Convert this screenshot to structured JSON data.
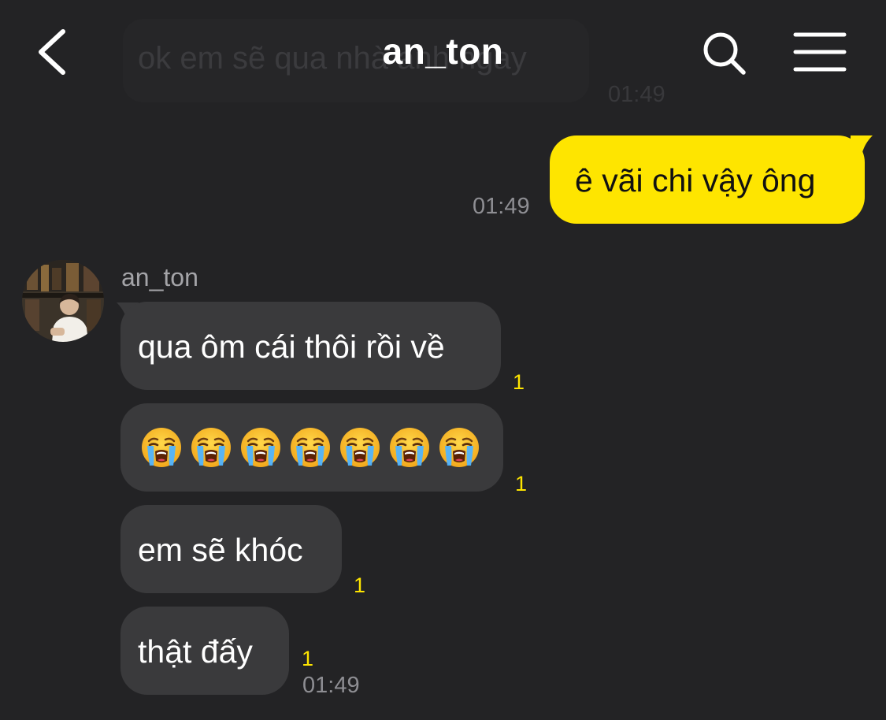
{
  "header": {
    "title": "an_ton",
    "back_icon": "chevron-left-icon",
    "search_icon": "search-icon",
    "menu_icon": "hamburger-menu-icon"
  },
  "ghost_message": {
    "text": "ok em sẽ qua nhà anh ngay",
    "time": "01:49"
  },
  "sent_message": {
    "text": "ê vãi chi vậy ông",
    "time": "01:49"
  },
  "received": {
    "sender_name": "an_ton",
    "avatar_icon": "avatar-photo",
    "messages": [
      {
        "text": "qua ôm cái thôi rồi về",
        "unread": "1"
      },
      {
        "text": "😭😭😭😭😭😭😭",
        "unread": "1",
        "emoji_icon": "loudly-crying-face-icon"
      },
      {
        "text": "em sẽ khóc",
        "unread": "1"
      },
      {
        "text": "thật đấy",
        "unread": "1"
      }
    ],
    "time": "01:49"
  },
  "colors": {
    "background": "#232325",
    "sent_bubble": "#fee500",
    "received_bubble": "#3a3a3c",
    "unread_count": "#fee500",
    "timestamp": "#8e8e93"
  }
}
